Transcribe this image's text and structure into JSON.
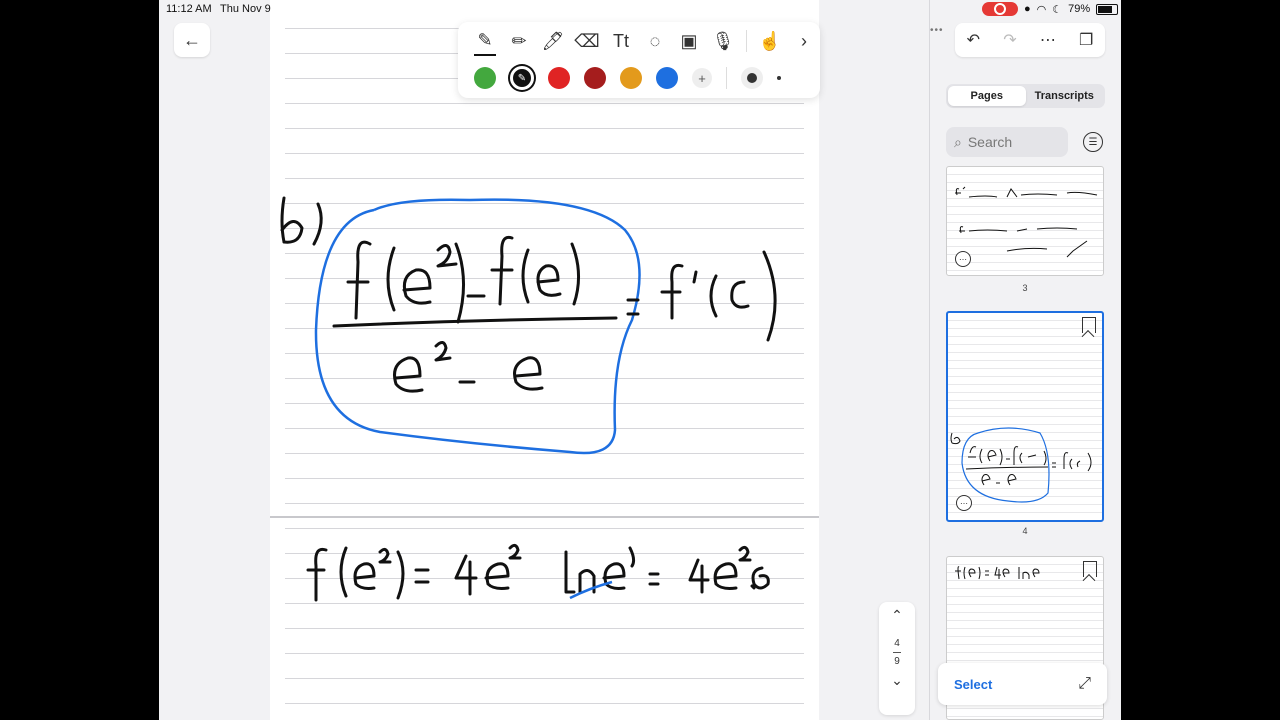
{
  "status_bar": {
    "time": "11:12 AM",
    "date": "Thu Nov 9",
    "battery": "79%"
  },
  "toolbar": {
    "tools": [
      "pen-icon",
      "pencil-icon",
      "highlighter-icon",
      "eraser-icon",
      "text-icon",
      "lasso-icon",
      "image-icon",
      "microphone-icon",
      "touch-icon",
      "chevron-right-icon"
    ],
    "colors": [
      "#43a83e",
      "#111111",
      "#e02424",
      "#a51d1d",
      "#e39a1c",
      "#1e6fe0"
    ],
    "selected_color": "#111111"
  },
  "accent_color": "#1e6fe0",
  "stepper": {
    "current": "4",
    "total": "9"
  },
  "sidebar": {
    "tabs": [
      {
        "label": "Pages",
        "active": true
      },
      {
        "label": "Transcripts",
        "active": false
      }
    ],
    "search_placeholder": "Search",
    "pages": [
      {
        "number": "3"
      },
      {
        "number": "4"
      },
      {
        "number": ""
      }
    ],
    "select_label": "Select"
  }
}
